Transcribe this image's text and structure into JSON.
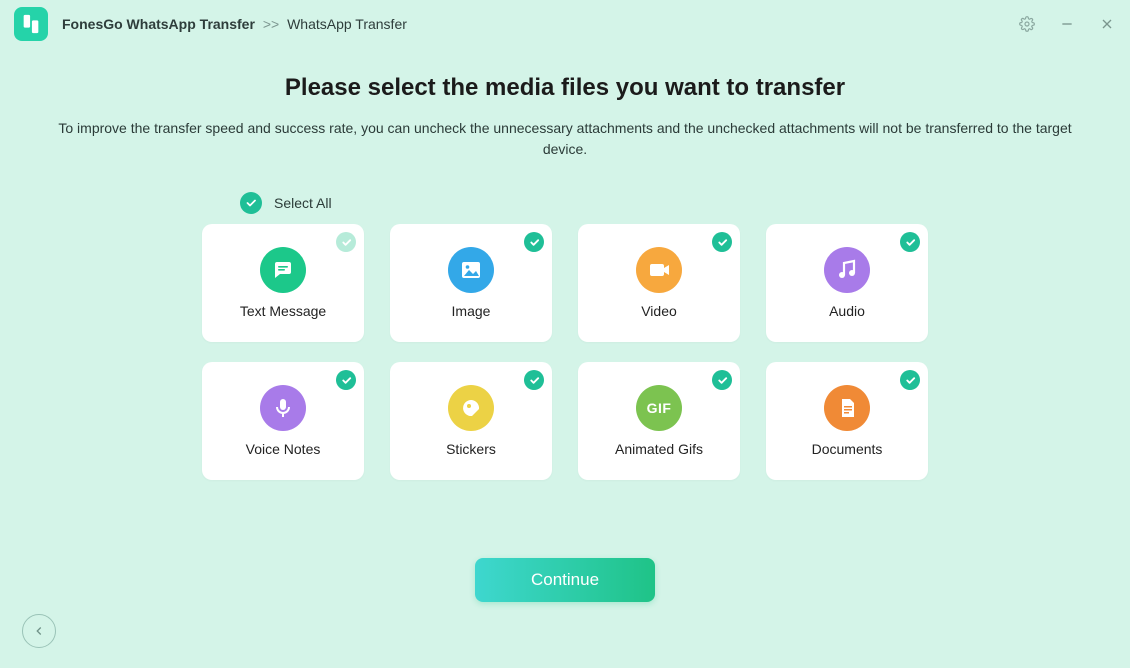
{
  "breadcrumb": {
    "root": "FonesGo WhatsApp Transfer",
    "sep": ">>",
    "leaf": "WhatsApp Transfer"
  },
  "heading": "Please select the media files you want to transfer",
  "subtitle": "To improve the transfer speed and success rate, you can uncheck the unnecessary attachments and the unchecked attachments will not be transferred to the target device.",
  "select_all": {
    "label": "Select All",
    "checked": true
  },
  "cards": {
    "text": {
      "label": "Text Message",
      "checked": true,
      "locked": true
    },
    "image": {
      "label": "Image",
      "checked": true
    },
    "video": {
      "label": "Video",
      "checked": true
    },
    "audio": {
      "label": "Audio",
      "checked": true
    },
    "voice": {
      "label": "Voice Notes",
      "checked": true
    },
    "sticker": {
      "label": "Stickers",
      "checked": true
    },
    "gif": {
      "label": "Animated Gifs",
      "checked": true,
      "badge": "GIF"
    },
    "doc": {
      "label": "Documents",
      "checked": true
    }
  },
  "continue_label": "Continue",
  "colors": {
    "accent": "#1fbf97",
    "bg": "#d4f4e8"
  }
}
